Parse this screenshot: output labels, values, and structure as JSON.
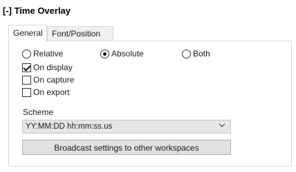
{
  "section": {
    "title": "[-] Time Overlay"
  },
  "tabs": [
    {
      "label": "General",
      "active": true
    },
    {
      "label": "Font/Position",
      "active": false
    }
  ],
  "mode": {
    "options": [
      "Relative",
      "Absolute",
      "Both"
    ],
    "selected": "Absolute"
  },
  "checkboxes": [
    {
      "label": "On display",
      "checked": true
    },
    {
      "label": "On capture",
      "checked": false
    },
    {
      "label": "On export",
      "checked": false
    }
  ],
  "scheme": {
    "label": "Scheme",
    "value": "YY:MM:DD hh:mm:ss.us"
  },
  "broadcast_button": {
    "label": "Broadcast settings to other workspaces"
  }
}
